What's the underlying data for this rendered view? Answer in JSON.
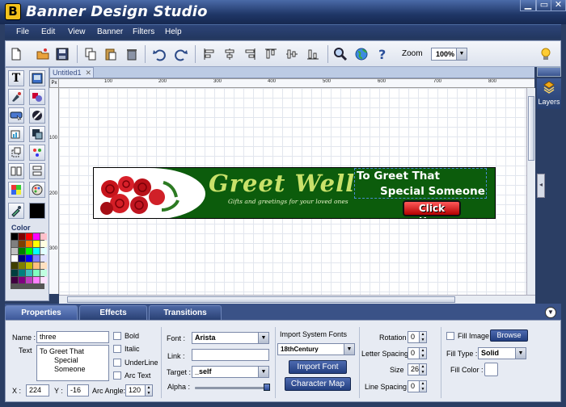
{
  "window": {
    "title": "Banner Design Studio",
    "logo_letter": "B",
    "min": "▁",
    "max": "▭",
    "close": "✕"
  },
  "menu": [
    "File",
    "Edit",
    "View",
    "Banner",
    "Filters",
    "Help"
  ],
  "toolbar": {
    "zoom_label": "Zoom",
    "zoom_value": "100%"
  },
  "document": {
    "tab": "Untitled1",
    "tab_close": "✕",
    "ruler_unit": "Px",
    "hruler_labels": [
      "100",
      "200",
      "300",
      "400",
      "500",
      "600",
      "700",
      "800"
    ],
    "vruler_labels": [
      "100",
      "200",
      "300"
    ]
  },
  "banner": {
    "headline": "Greet Well",
    "tagline": "Gifts and greetings for your loved ones",
    "line1": "To Greet That",
    "line2": "Special Someone",
    "button": "Click Here"
  },
  "color_panel": {
    "label": "Color",
    "swatches": [
      "#000000",
      "#7f0000",
      "#ff0000",
      "#ff00ff",
      "#ffc0cb",
      "#7f7f7f",
      "#7f3f00",
      "#ff7f00",
      "#ffff00",
      "#ffffe0",
      "#c0c0c0",
      "#007f00",
      "#00ff00",
      "#00ffff",
      "#e0ffff",
      "#ffffff",
      "#00007f",
      "#0000ff",
      "#7f7fff",
      "#e0e0ff",
      "#3f3f00",
      "#7f7f00",
      "#bfbf00",
      "#ffbf7f",
      "#ffe0c0",
      "#003f3f",
      "#007f7f",
      "#3fbfbf",
      "#7fffbf",
      "#c0ffe0",
      "#3f003f",
      "#7f007f",
      "#bf3fbf",
      "#ff7fff",
      "#ffe0ff"
    ]
  },
  "right_panel": {
    "layers": "Layers",
    "collapse": "◂"
  },
  "bottom_tabs": {
    "properties": "Properties",
    "effects": "Effects",
    "transitions": "Transitions"
  },
  "props": {
    "name_label": "Name :",
    "name_value": "three",
    "text_label": "Text",
    "text_line1": "To Greet That",
    "text_line2": "Special Someone",
    "bold": "Bold",
    "italic": "Italic",
    "underline": "UnderLine",
    "arc_text": "Arc Text",
    "x_label": "X :",
    "x_value": "224",
    "y_label": "Y :",
    "y_value": "-16",
    "arc_angle_label": "Arc Angle:",
    "arc_angle_value": "120",
    "font_label": "Font :",
    "font_value": "Arista",
    "link_label": "Link :",
    "link_value": "",
    "target_label": "Target :",
    "target_value": "_self",
    "alpha_label": "Alpha :",
    "import_system_fonts": "Import System Fonts",
    "system_font_value": "18thCentury",
    "import_font_btn": "Import Font",
    "character_map_btn": "Character Map",
    "rotation_label": "Rotation",
    "rotation_value": "0",
    "letter_spacing_label": "Letter Spacing",
    "letter_spacing_value": "0",
    "size_label": "Size",
    "size_value": "26",
    "line_spacing_label": "Line Spacing",
    "line_spacing_value": "0",
    "fill_image_label": "Fill Image",
    "browse_btn": "Browse",
    "fill_type_label": "Fill Type :",
    "fill_type_value": "Solid",
    "fill_color_label": "Fill Color :"
  }
}
